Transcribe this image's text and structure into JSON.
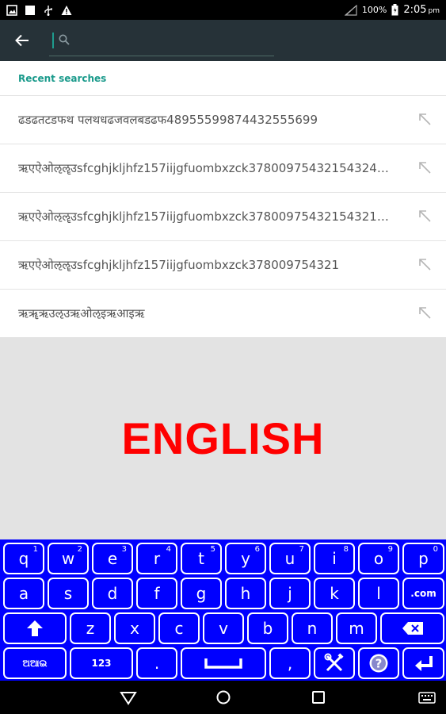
{
  "status_bar": {
    "battery": "100%",
    "time": "2:05",
    "ampm": "pm",
    "left_icons": [
      "gallery-icon",
      "square-icon",
      "usb-icon",
      "warning-icon"
    ],
    "right_icons": [
      "signal-icon",
      "battery-icon"
    ]
  },
  "app_bar": {
    "back_icon": "arrow-left-icon",
    "search_placeholder": "Search",
    "search_value": ""
  },
  "recent": {
    "title": "Recent searches",
    "items": [
      {
        "text": "ढडढतटडफथ पलथधढजवलबडढफ48955599874432555699"
      },
      {
        "text": "ऋएऐओऌॡउsfcghjkljhfz157iijgfuombxzck37800975432154324…"
      },
      {
        "text": "ऋएऐओऌॡउsfcghjkljhfz157iijgfuombxzck37800975432154321…"
      },
      {
        "text": "ऋएऐओऌॡउsfcghjkljhfz157iijgfuombxzck378009754321"
      },
      {
        "text": "ऋॠऋउऌउऋओऌइऋआइऋ"
      }
    ]
  },
  "banner": {
    "language": "ENGLISH"
  },
  "keyboard": {
    "colors": {
      "background": "#0000ff",
      "key_border": "#ffffff"
    },
    "row1": [
      {
        "label": "q",
        "hint": "1"
      },
      {
        "label": "w",
        "hint": "2"
      },
      {
        "label": "e",
        "hint": "3"
      },
      {
        "label": "r",
        "hint": "4"
      },
      {
        "label": "t",
        "hint": "5"
      },
      {
        "label": "y",
        "hint": "6"
      },
      {
        "label": "u",
        "hint": "7"
      },
      {
        "label": "i",
        "hint": "8"
      },
      {
        "label": "o",
        "hint": "9"
      },
      {
        "label": "p",
        "hint": "0"
      }
    ],
    "row2": [
      {
        "label": "a"
      },
      {
        "label": "s"
      },
      {
        "label": "d"
      },
      {
        "label": "f"
      },
      {
        "label": "g"
      },
      {
        "label": "h"
      },
      {
        "label": "j"
      },
      {
        "label": "k"
      },
      {
        "label": "l"
      },
      {
        "label": ".com"
      }
    ],
    "row3": [
      {
        "label": "z"
      },
      {
        "label": "x"
      },
      {
        "label": "c"
      },
      {
        "label": "v"
      },
      {
        "label": "b"
      },
      {
        "label": "n"
      },
      {
        "label": "m"
      }
    ],
    "row4": {
      "lang_switch": "ଅଆଇ",
      "numbers": "123",
      "period": ".",
      "comma": ","
    },
    "icons": [
      "shift-icon",
      "backspace-icon",
      "spacebar-icon",
      "settings-tools-icon",
      "help-icon",
      "enter-icon"
    ]
  },
  "nav_bar": {
    "icons": [
      "back-triangle-icon",
      "home-circle-icon",
      "recents-square-icon",
      "keyboard-icon"
    ]
  }
}
